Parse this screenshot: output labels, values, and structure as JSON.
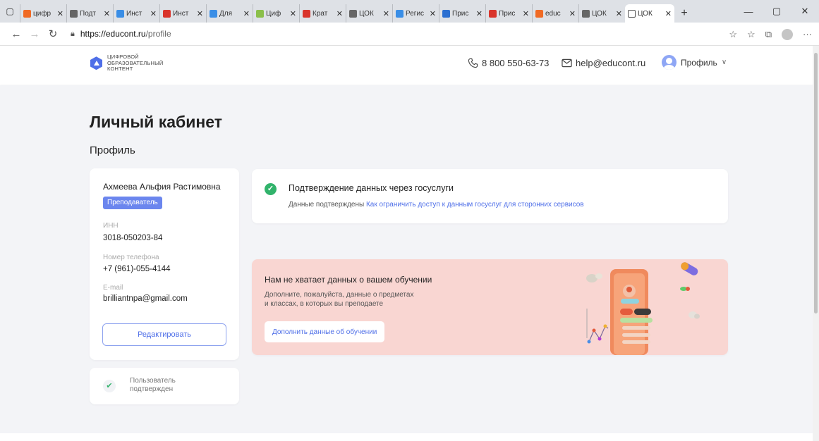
{
  "browser": {
    "tabs": [
      {
        "label": "цифр",
        "color": "#f06a24"
      },
      {
        "label": "Подт",
        "color": "#666666"
      },
      {
        "label": "Инст",
        "color": "#3a8ee6"
      },
      {
        "label": "Инст",
        "color": "#d9342b"
      },
      {
        "label": "Для",
        "color": "#3a8ee6"
      },
      {
        "label": "Циф",
        "color": "#8bbf4a"
      },
      {
        "label": "Крат",
        "color": "#d9342b"
      },
      {
        "label": "ЦОК",
        "color": "#666666"
      },
      {
        "label": "Регис",
        "color": "#3a8ee6"
      },
      {
        "label": "Прис",
        "color": "#2b6fd1"
      },
      {
        "label": "Прис",
        "color": "#d9342b"
      },
      {
        "label": "educ",
        "color": "#f06a24"
      },
      {
        "label": "ЦОК",
        "color": "#666666"
      }
    ],
    "active_tab": "ЦОК",
    "url_host": "https://educont.ru",
    "url_path": "/profile"
  },
  "header": {
    "logo_line1": "ЦИФРОВОЙ",
    "logo_line2": "ОБРАЗОВАТЕЛЬНЫЙ",
    "logo_line3": "КОНТЕНТ",
    "phone": "8 800 550-63-73",
    "email": "help@educont.ru",
    "profile_label": "Профиль"
  },
  "main": {
    "title": "Личный кабинет",
    "section": "Профиль"
  },
  "profile": {
    "name": "Ахмеева Альфия Растимовна",
    "role": "Преподаватель",
    "inn_label": "ИНН",
    "inn": "3018-050203-84",
    "phone_label": "Номер телефона",
    "phone": "+7 (961)-055-4144",
    "email_label": "E-mail",
    "email": "brilliantnpa@gmail.com",
    "edit_button": "Редактировать"
  },
  "verified": {
    "line1": "Пользователь",
    "line2": "подтвержден"
  },
  "gosuslugi": {
    "title": "Подтверждение данных через госуслуги",
    "status": "Данные подтверждены",
    "link": "Как ограничить доступ к данным госуслуг для сторонних сервисов"
  },
  "promo": {
    "title": "Нам не хватает данных о вашем обучении",
    "desc_line1": "Дополните, пожалуйста, данные о предметах",
    "desc_line2": "и классах, в которых вы преподаете",
    "button": "Дополнить данные об обучении"
  },
  "colors": {
    "accent": "#4f6fe8",
    "badge": "#6b86ee",
    "success": "#31b36b",
    "promo_bg": "#f9d6d2",
    "page_bg": "#f3f4f7"
  }
}
